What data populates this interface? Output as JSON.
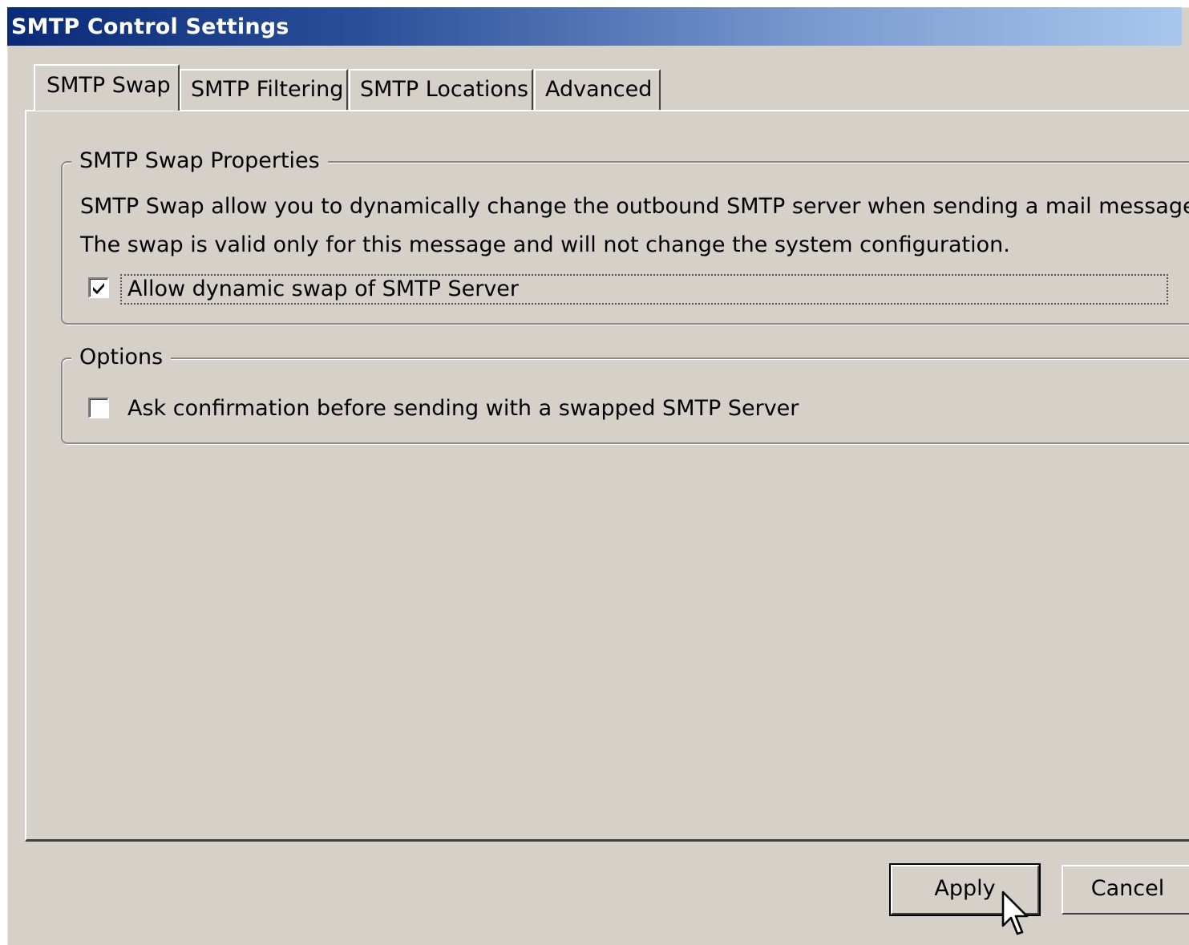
{
  "window": {
    "title": "SMTP Control Settings"
  },
  "tabs": [
    {
      "label": "SMTP Swap",
      "active": true
    },
    {
      "label": "SMTP Filtering",
      "active": false
    },
    {
      "label": "SMTP Locations",
      "active": false
    },
    {
      "label": "Advanced",
      "active": false
    }
  ],
  "swap_properties": {
    "legend": "SMTP Swap Properties",
    "description_line1": "SMTP Swap allow you to dynamically change the outbound SMTP server when sending a mail message.",
    "description_line2": "The swap is valid only for this message and will not change the system configuration.",
    "allow_swap": {
      "label": "Allow dynamic swap of SMTP Server",
      "checked": true
    }
  },
  "options": {
    "legend": "Options",
    "ask_confirmation": {
      "label": "Ask confirmation before sending with a swapped SMTP Server",
      "checked": false
    }
  },
  "buttons": {
    "apply_label": "Apply",
    "cancel_label": "Cancel"
  },
  "icons": {
    "cursor": "mouse-pointer-icon",
    "check": "checkmark-icon"
  },
  "colors": {
    "title_start": "#0b2a78",
    "title_end": "#a9c6ee",
    "dialog_bg": "#d5d1c9"
  }
}
